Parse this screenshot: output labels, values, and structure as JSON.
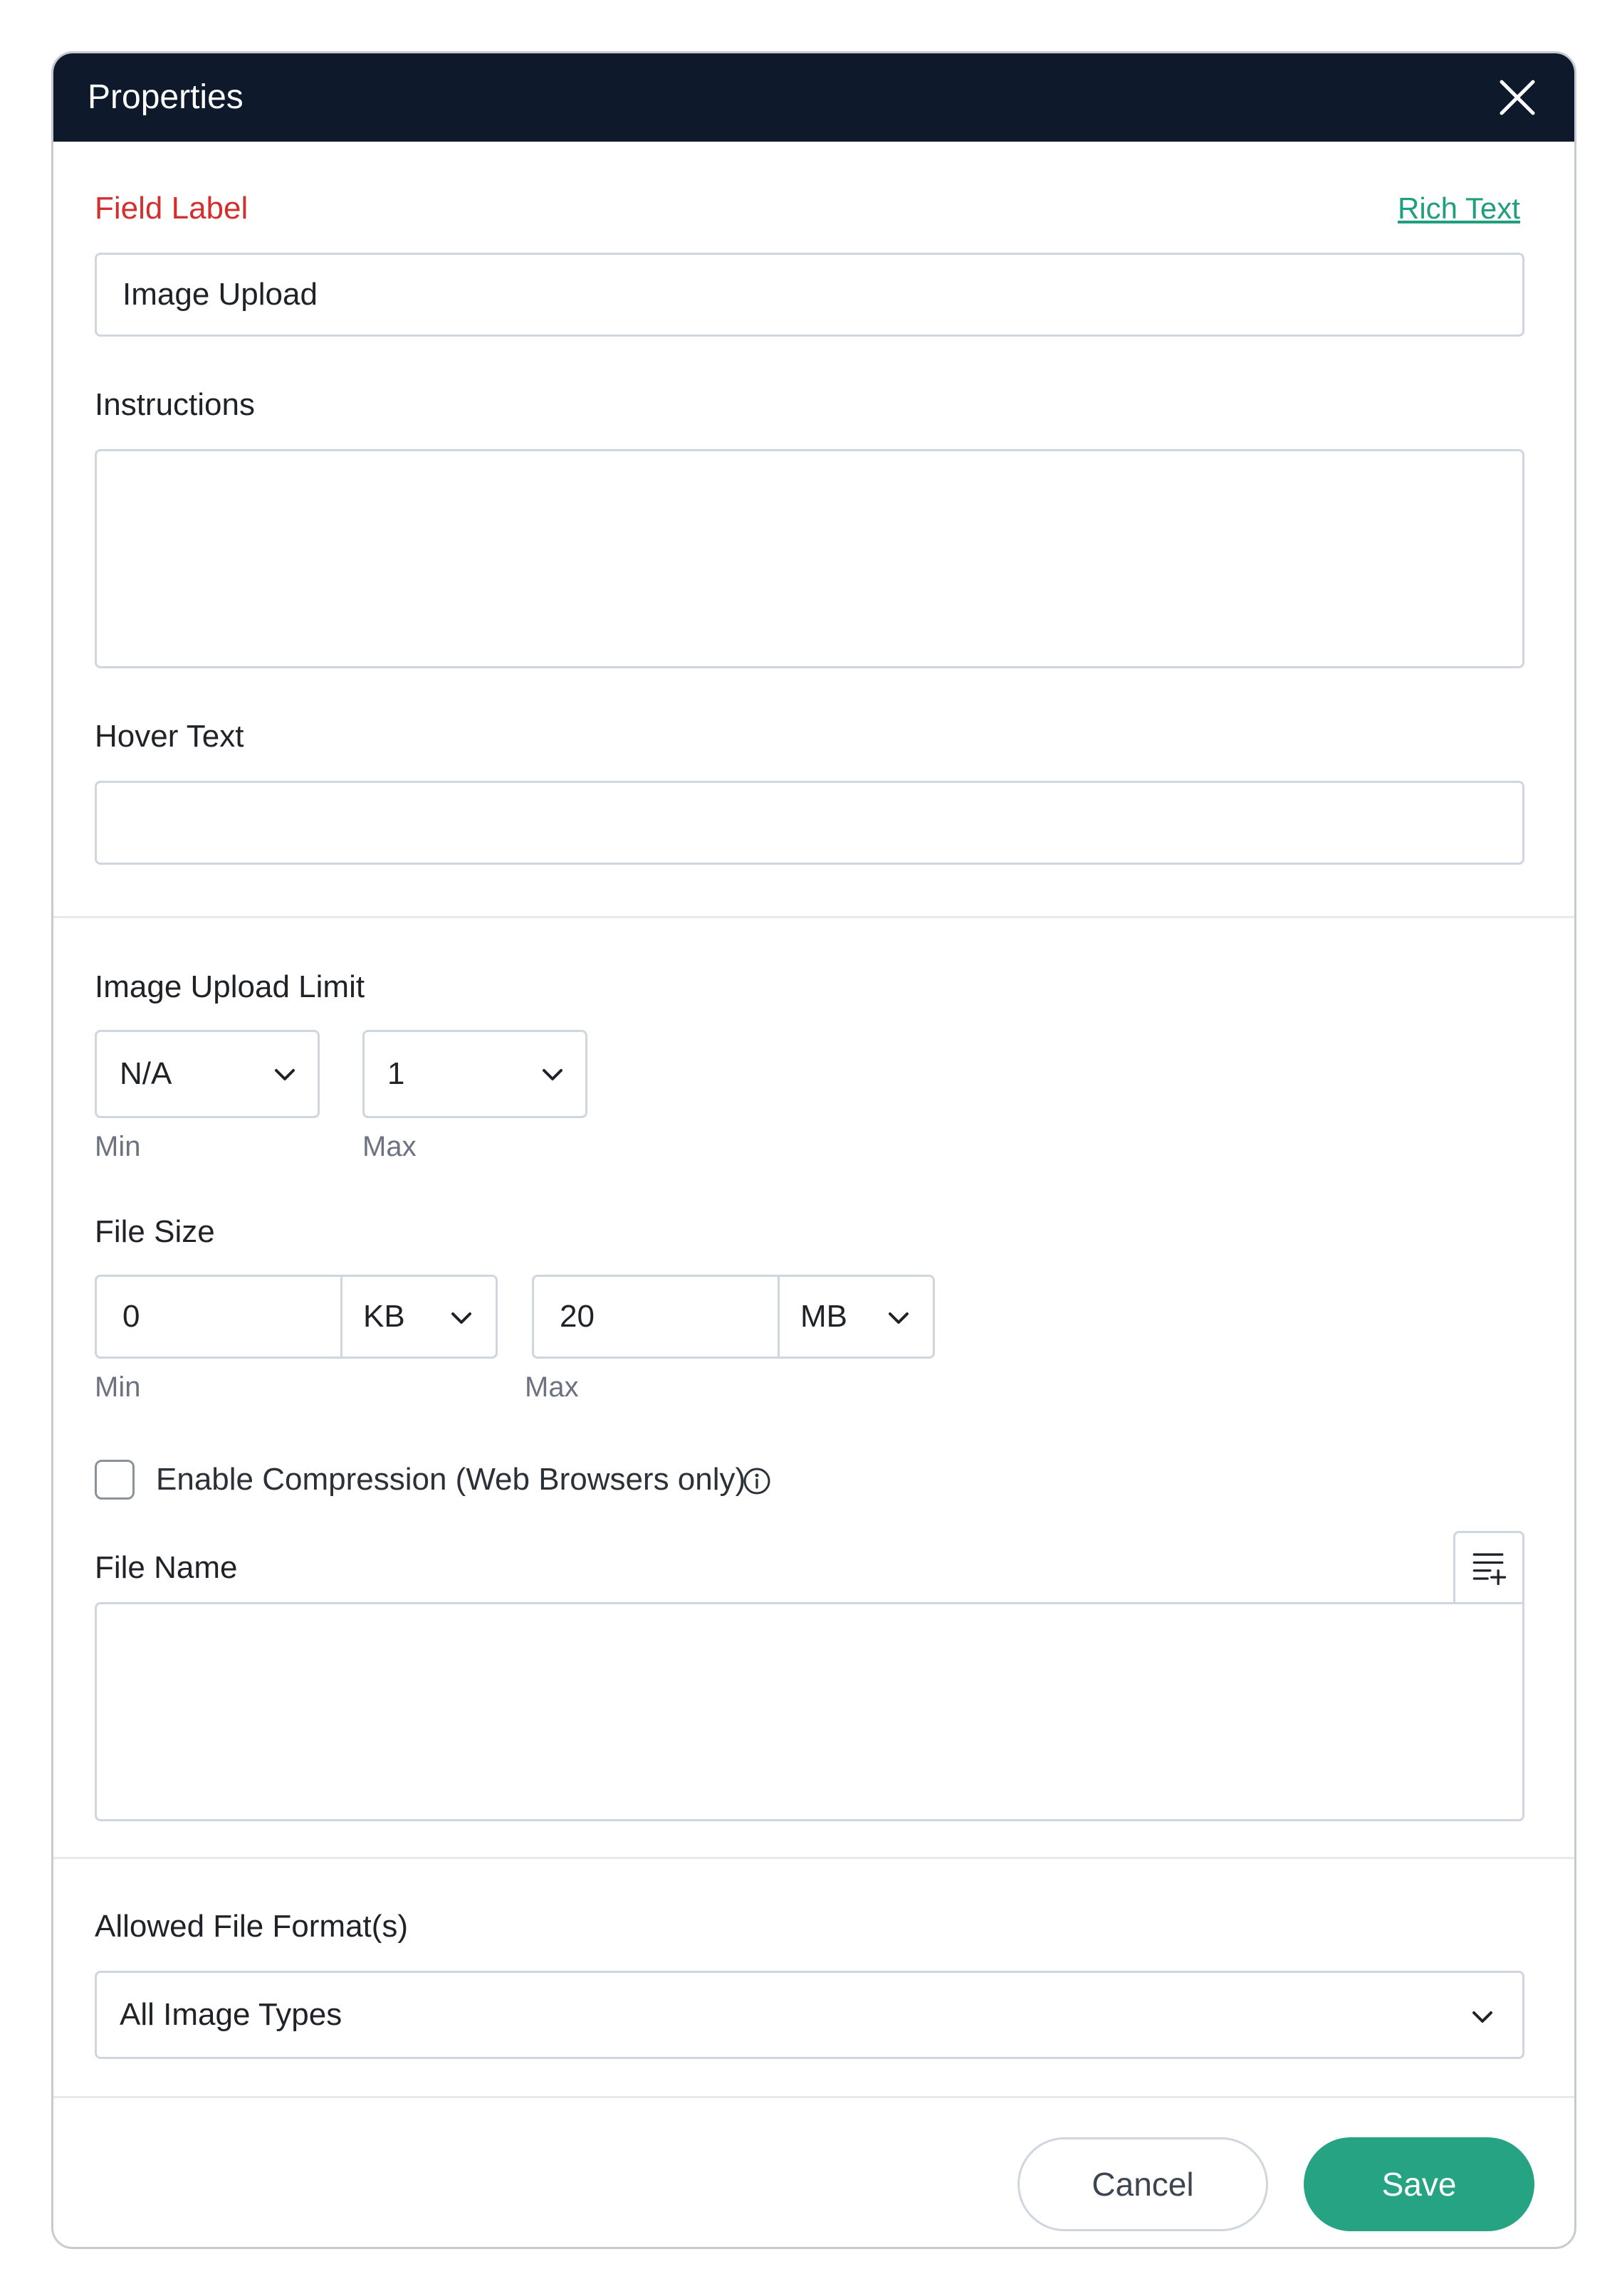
{
  "dialog": {
    "title": "Properties",
    "close_icon": "close-icon"
  },
  "field_label": {
    "label": "Field Label",
    "rich_text_link": "Rich Text",
    "value": "Image Upload"
  },
  "instructions": {
    "label": "Instructions",
    "value": ""
  },
  "hover_text": {
    "label": "Hover Text",
    "value": ""
  },
  "image_upload_limit": {
    "label": "Image Upload Limit",
    "min_value": "N/A",
    "min_label": "Min",
    "max_value": "1",
    "max_label": "Max"
  },
  "file_size": {
    "label": "File Size",
    "min_value": "0",
    "min_unit": "KB",
    "min_label": "Min",
    "max_value": "20",
    "max_unit": "MB",
    "max_label": "Max"
  },
  "compression": {
    "label": "Enable Compression (Web Browsers only)",
    "checked": false
  },
  "file_name": {
    "label": "File Name",
    "value": ""
  },
  "allowed_formats": {
    "label": "Allowed File Format(s)",
    "value": "All Image Types"
  },
  "footer": {
    "cancel_label": "Cancel",
    "save_label": "Save"
  },
  "colors": {
    "header_bg": "#0e1a2c",
    "required_label": "#d32f2f",
    "link": "#1f9e80",
    "save_button": "#26a383"
  }
}
